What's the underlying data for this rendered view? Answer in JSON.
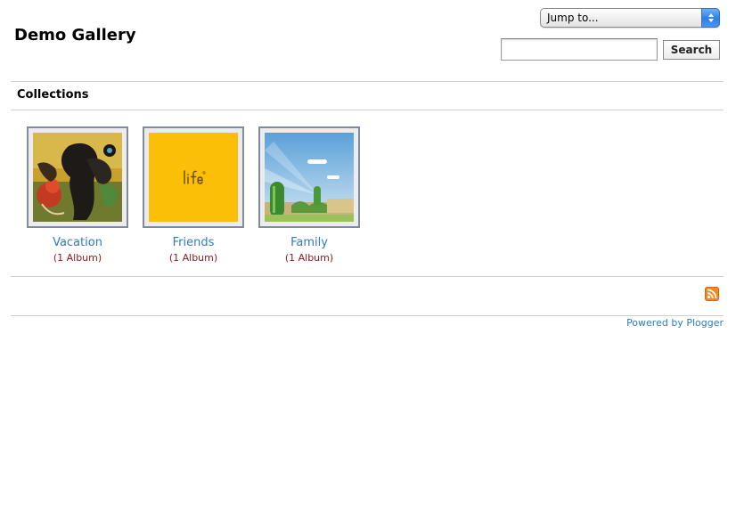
{
  "header": {
    "title": "Demo Gallery",
    "jump_label": "Jump to...",
    "search_value": "",
    "search_button": "Search"
  },
  "collections_heading": "Collections",
  "collections": [
    {
      "name": "Vacation",
      "count": "(1 Album)"
    },
    {
      "name": "Friends",
      "count": "(1 Album)"
    },
    {
      "name": "Family",
      "count": "(1 Album)"
    }
  ],
  "footer": {
    "rss_icon": "rss-feed-icon",
    "powered_by": "Powered by Plogger"
  },
  "colors": {
    "link": "#2f7bbf",
    "count": "#8b1a1a",
    "thumb_border": "#7f8a9c",
    "rss_orange": "#f38a1f",
    "friends_thumb_yellow": "#fbbf08"
  }
}
